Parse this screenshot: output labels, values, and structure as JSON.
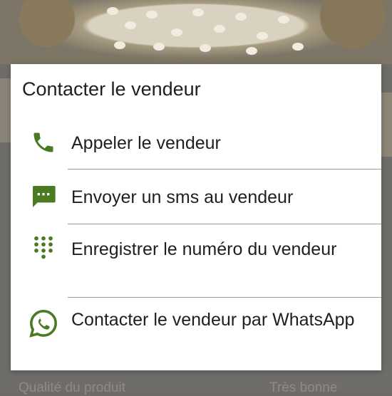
{
  "background": {
    "footer_left": "Qualité du produit",
    "footer_right": "Très bonne"
  },
  "dialog": {
    "title": "Contacter le vendeur",
    "options": [
      {
        "label": "Appeler le vendeur",
        "icon": "phone-icon"
      },
      {
        "label": "Envoyer un sms au vendeur",
        "icon": "sms-icon"
      },
      {
        "label": "Enregistrer le numéro du vendeur",
        "icon": "dialpad-icon"
      },
      {
        "label": "Contacter le vendeur par WhatsApp",
        "icon": "whatsapp-icon"
      }
    ]
  },
  "colors": {
    "icon_green": "#4a7a22",
    "dialog_bg": "#ffffff",
    "text": "#1f1f1f",
    "divider": "#9e9e9e"
  }
}
